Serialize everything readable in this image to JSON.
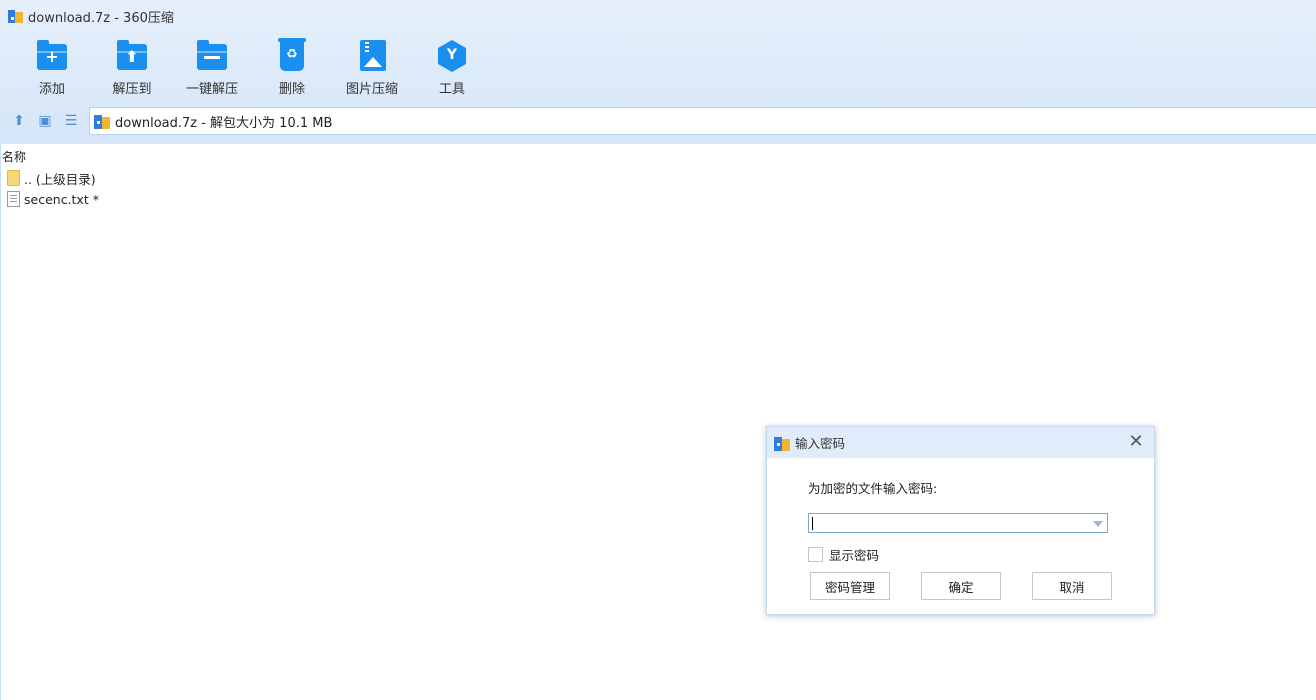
{
  "window": {
    "title": "download.7z - 360压缩"
  },
  "toolbar": {
    "items": [
      {
        "label": "添加",
        "icon": "add-folder-icon"
      },
      {
        "label": "解压到",
        "icon": "extract-to-icon"
      },
      {
        "label": "一键解压",
        "icon": "one-click-extract-icon"
      },
      {
        "label": "删除",
        "icon": "delete-bin-icon"
      },
      {
        "label": "图片压缩",
        "icon": "image-compress-icon"
      },
      {
        "label": "工具",
        "icon": "tools-hex-icon"
      }
    ],
    "accent": "#1a8ff0"
  },
  "address": {
    "text": "download.7z - 解包大小为 10.1 MB"
  },
  "filelist": {
    "column_header": "名称",
    "rows": [
      {
        "name": ".. (上级目录)",
        "type": "folder"
      },
      {
        "name": "secenc.txt *",
        "type": "file"
      }
    ]
  },
  "dialog": {
    "title": "输入密码",
    "prompt": "为加密的文件输入密码:",
    "password_value": "",
    "show_password_label": "显示密码",
    "show_password_checked": false,
    "buttons": {
      "manage": "密码管理",
      "ok": "确定",
      "cancel": "取消"
    }
  }
}
